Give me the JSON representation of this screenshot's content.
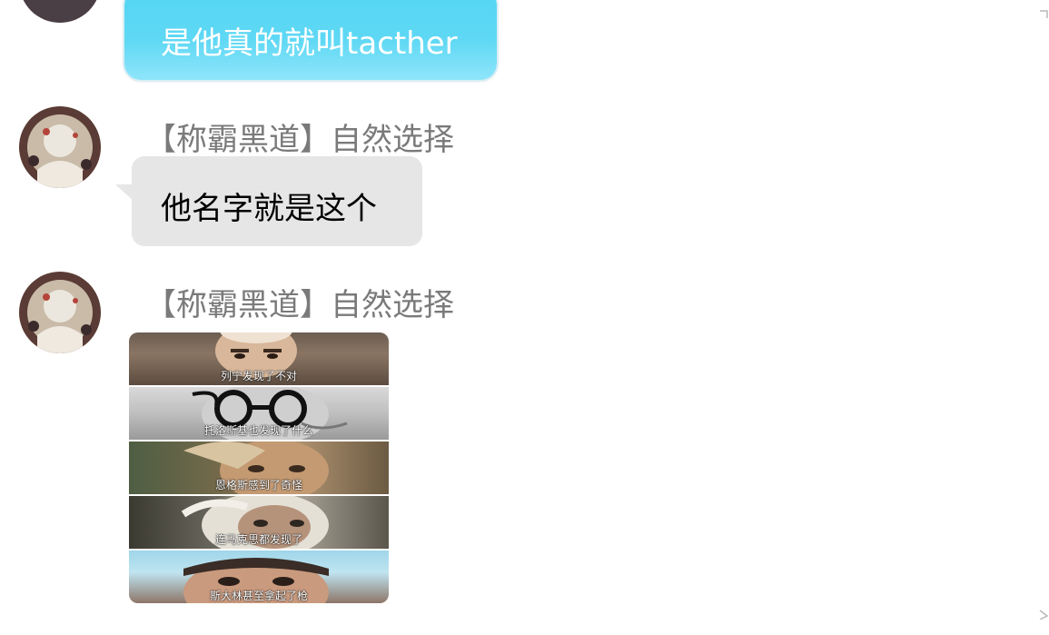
{
  "messages": [
    {
      "type": "text",
      "style": "self-blue",
      "text": "是他真的就叫tacther"
    },
    {
      "type": "text",
      "style": "other-gray",
      "sender": "【称霸黑道】自然选择",
      "text": "他名字就是这个"
    },
    {
      "type": "image",
      "sender": "【称霸黑道】自然选择",
      "captions": [
        "列宁发现了不对",
        "托洛斯基也发现了什么",
        "恩格斯感到了奇怪",
        "连马克思都发现了",
        "斯大林甚至拿起了枪"
      ]
    }
  ],
  "icons": {
    "scroll_up": "chevron-up-icon",
    "scroll_down": "chevron-down-icon"
  },
  "colors": {
    "self_bubble": "#5ed8f4",
    "other_bubble": "#e6e6e6",
    "sender_name": "#7a7a7a"
  }
}
